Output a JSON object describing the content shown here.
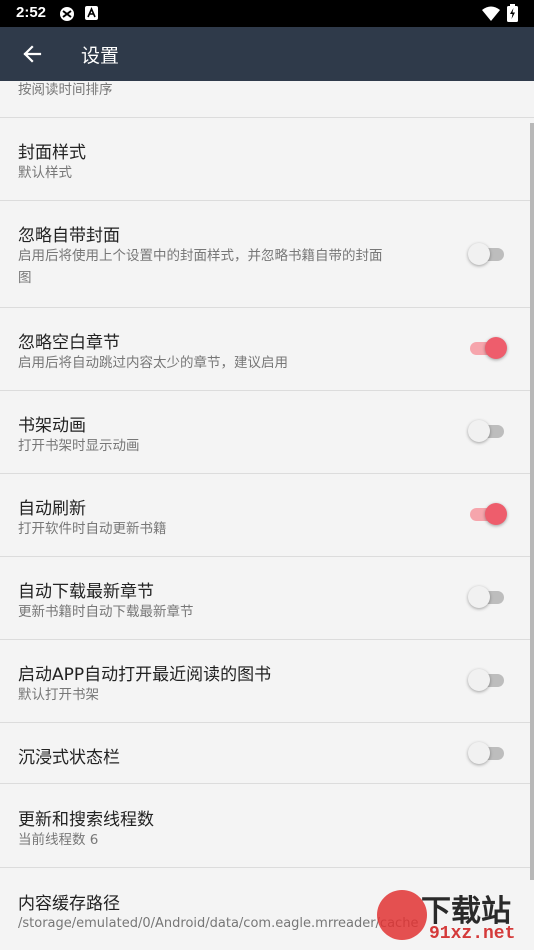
{
  "status_bar": {
    "time": "2:52"
  },
  "app_bar": {
    "title": "设置"
  },
  "settings": [
    {
      "summary": "按阅读时间排序"
    },
    {
      "title": "封面样式",
      "summary": "默认样式"
    },
    {
      "title": "忽略自带封面",
      "summary_line1": "启用后将使用上个设置中的封面样式，并忽略书籍自带的封面",
      "summary_line2": "图",
      "enabled": false
    },
    {
      "title": "忽略空白章节",
      "summary": "启用后将自动跳过内容太少的章节，建议启用",
      "enabled": true
    },
    {
      "title": "书架动画",
      "summary": "打开书架时显示动画",
      "enabled": false
    },
    {
      "title": "自动刷新",
      "summary": "打开软件时自动更新书籍",
      "enabled": true
    },
    {
      "title": "自动下载最新章节",
      "summary": "更新书籍时自动下载最新章节",
      "enabled": false
    },
    {
      "title": "启动APP自动打开最近阅读的图书",
      "summary": "默认打开书架",
      "enabled": false
    },
    {
      "title": "沉浸式状态栏",
      "enabled": false
    },
    {
      "title": "更新和搜索线程数",
      "summary": "当前线程数 6"
    },
    {
      "title": "内容缓存路径",
      "summary": "/storage/emulated/0/Android/data/com.eagle.mrreader/cache"
    }
  ],
  "watermark": {
    "brand": "下载站",
    "site": "91xz.net"
  },
  "colors": {
    "app_bar": "#2f3a4a",
    "accent": "#ee5d6c",
    "accent_track": "#f6a5ac"
  }
}
